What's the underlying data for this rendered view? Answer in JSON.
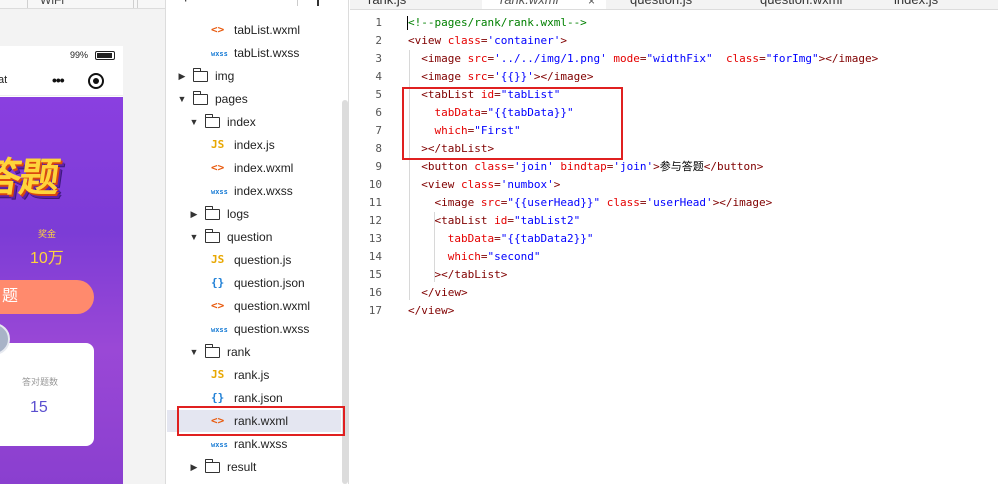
{
  "simulator": {
    "toolbar": {
      "device_select": "",
      "network_select": "WiFi"
    },
    "status_bar": {
      "battery": "99%"
    },
    "nav_bar": {
      "title": "at"
    },
    "page": {
      "banner_title": "答题",
      "prize_label": "奖金",
      "prize_amount": "10万",
      "join_button": "题",
      "stats_label": "答对题数",
      "stats_value": "15"
    }
  },
  "explorer": {
    "items": [
      {
        "type": "file",
        "kind": "wxml",
        "icon": "<>",
        "label": "tabList.wxml"
      },
      {
        "type": "file",
        "kind": "wxss",
        "icon": "wxss",
        "label": "tabList.wxss"
      },
      {
        "type": "folder",
        "expanded": false,
        "label": "img"
      },
      {
        "type": "folder",
        "expanded": true,
        "label": "pages"
      },
      {
        "type": "folder",
        "expanded": true,
        "label": "index"
      },
      {
        "type": "file",
        "kind": "js",
        "icon": "JS",
        "label": "index.js"
      },
      {
        "type": "file",
        "kind": "wxml",
        "icon": "<>",
        "label": "index.wxml"
      },
      {
        "type": "file",
        "kind": "wxss",
        "icon": "wxss",
        "label": "index.wxss"
      },
      {
        "type": "folder",
        "expanded": false,
        "label": "logs"
      },
      {
        "type": "folder",
        "expanded": true,
        "label": "question"
      },
      {
        "type": "file",
        "kind": "js",
        "icon": "JS",
        "label": "question.js"
      },
      {
        "type": "file",
        "kind": "json",
        "icon": "{}",
        "label": "question.json"
      },
      {
        "type": "file",
        "kind": "wxml",
        "icon": "<>",
        "label": "question.wxml"
      },
      {
        "type": "file",
        "kind": "wxss",
        "icon": "wxss",
        "label": "question.wxss"
      },
      {
        "type": "folder",
        "expanded": true,
        "label": "rank"
      },
      {
        "type": "file",
        "kind": "js",
        "icon": "JS",
        "label": "rank.js"
      },
      {
        "type": "file",
        "kind": "json",
        "icon": "{}",
        "label": "rank.json"
      },
      {
        "type": "file",
        "kind": "wxml",
        "icon": "<>",
        "label": "rank.wxml",
        "selected": true
      },
      {
        "type": "file",
        "kind": "wxss",
        "icon": "wxss",
        "label": "rank.wxss"
      },
      {
        "type": "folder",
        "expanded": false,
        "label": "result"
      }
    ]
  },
  "editor": {
    "tabs": [
      {
        "label": "rank.js",
        "active": false
      },
      {
        "label": "rank.wxml",
        "active": true
      },
      {
        "label": "question.js",
        "active": false
      },
      {
        "label": "question.wxml",
        "active": false
      },
      {
        "label": "index.js",
        "active": false
      }
    ],
    "close_icon": "×",
    "line_numbers": [
      "1",
      "2",
      "3",
      "4",
      "5",
      "6",
      "7",
      "8",
      "9",
      "10",
      "11",
      "12",
      "13",
      "14",
      "15",
      "16",
      "17"
    ],
    "lines": [
      [
        [
          "c",
          "<!--pages/rank/rank.wxml-->"
        ]
      ],
      [
        [
          "g",
          "<view "
        ],
        [
          "a",
          "class"
        ],
        [
          "g",
          "="
        ],
        [
          "s",
          "'container'"
        ],
        [
          "g",
          ">"
        ]
      ],
      [
        [
          "g",
          "  <image "
        ],
        [
          "a",
          "src"
        ],
        [
          "g",
          "="
        ],
        [
          "s",
          "'../../img/1.png'"
        ],
        [
          "g",
          " "
        ],
        [
          "a",
          "mode"
        ],
        [
          "g",
          "="
        ],
        [
          "s",
          "\"widthFix\""
        ],
        [
          "g",
          "  "
        ],
        [
          "a",
          "class"
        ],
        [
          "g",
          "="
        ],
        [
          "s",
          "\"forImg\""
        ],
        [
          "g",
          "></image>"
        ]
      ],
      [
        [
          "g",
          "  <image "
        ],
        [
          "a",
          "src"
        ],
        [
          "g",
          "="
        ],
        [
          "s",
          "'{{}}'"
        ],
        [
          "g",
          "></image>"
        ]
      ],
      [
        [
          "g",
          "  <tabList "
        ],
        [
          "a",
          "id"
        ],
        [
          "g",
          "="
        ],
        [
          "s",
          "\"tabList\""
        ]
      ],
      [
        [
          "g",
          "    "
        ],
        [
          "a",
          "tabData"
        ],
        [
          "g",
          "="
        ],
        [
          "s",
          "\"{{tabData}}\""
        ]
      ],
      [
        [
          "g",
          "    "
        ],
        [
          "a",
          "which"
        ],
        [
          "g",
          "="
        ],
        [
          "s",
          "\"First\""
        ]
      ],
      [
        [
          "g",
          "  ></tabList>"
        ]
      ],
      [
        [
          "g",
          "  <button "
        ],
        [
          "a",
          "class"
        ],
        [
          "g",
          "="
        ],
        [
          "s",
          "'join'"
        ],
        [
          "g",
          " "
        ],
        [
          "a",
          "bindtap"
        ],
        [
          "g",
          "="
        ],
        [
          "s",
          "'join'"
        ],
        [
          "g",
          ">"
        ],
        [
          "t",
          "参与答题"
        ],
        [
          "g",
          "</button>"
        ]
      ],
      [
        [
          "g",
          "  <view "
        ],
        [
          "a",
          "class"
        ],
        [
          "g",
          "="
        ],
        [
          "s",
          "'numbox'"
        ],
        [
          "g",
          ">"
        ]
      ],
      [
        [
          "g",
          "    <image "
        ],
        [
          "a",
          "src"
        ],
        [
          "g",
          "="
        ],
        [
          "s",
          "\"{{userHead}}\""
        ],
        [
          "g",
          " "
        ],
        [
          "a",
          "class"
        ],
        [
          "g",
          "="
        ],
        [
          "s",
          "'userHead'"
        ],
        [
          "g",
          "></image>"
        ]
      ],
      [
        [
          "g",
          "    <tabList "
        ],
        [
          "a",
          "id"
        ],
        [
          "g",
          "="
        ],
        [
          "s",
          "\"tabList2\""
        ]
      ],
      [
        [
          "g",
          "      "
        ],
        [
          "a",
          "tabData"
        ],
        [
          "g",
          "="
        ],
        [
          "s",
          "\"{{tabData2}}\""
        ]
      ],
      [
        [
          "g",
          "      "
        ],
        [
          "a",
          "which"
        ],
        [
          "g",
          "="
        ],
        [
          "s",
          "\"second\""
        ]
      ],
      [
        [
          "g",
          "    ></tabList>"
        ]
      ],
      [
        [
          "g",
          "  </view>"
        ]
      ],
      [
        [
          "g",
          "</view>"
        ]
      ]
    ]
  },
  "colors": {
    "annotation": "#e02020",
    "phone_gradient_top": "#8a3fe0",
    "prize_yellow": "#ffd43b",
    "join_button": "#ff8a6d",
    "stats_value": "#5a4fcf",
    "code_comment": "#008000",
    "code_tag": "#800000",
    "code_attr": "#e50000",
    "code_string": "#0000ff"
  }
}
